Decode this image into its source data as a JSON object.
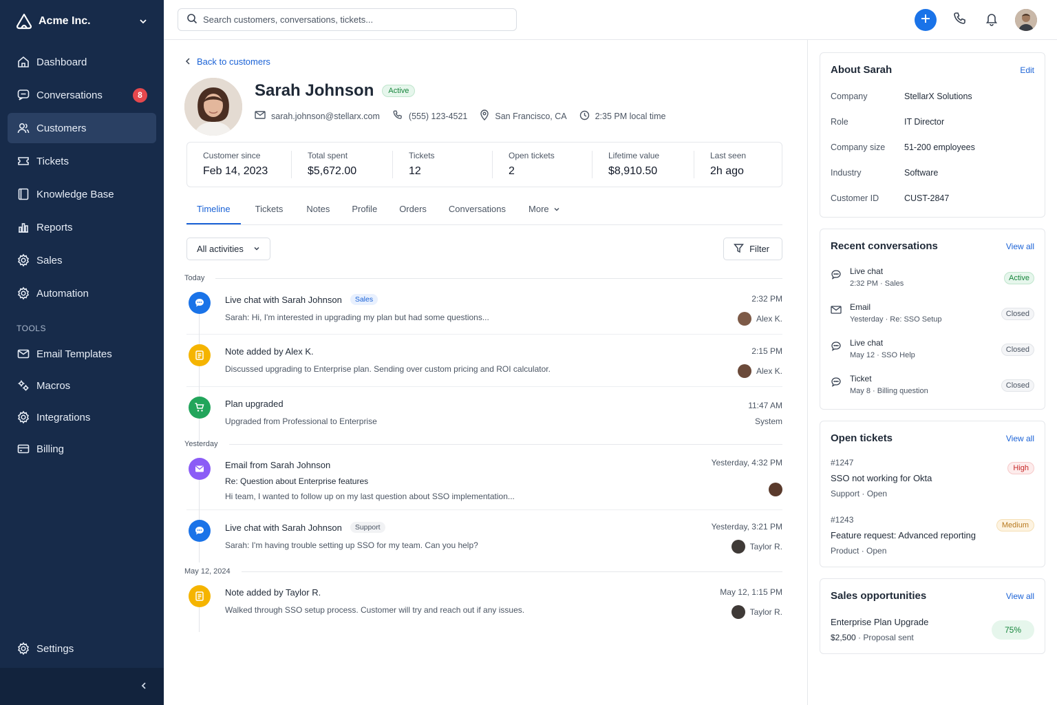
{
  "sidebar": {
    "brand": "Acme Inc.",
    "nav": [
      {
        "label": "Dashboard",
        "icon": "home-icon"
      },
      {
        "label": "Conversations",
        "icon": "chat-icon",
        "badge": "8"
      },
      {
        "label": "Customers",
        "icon": "users-icon",
        "active": true
      },
      {
        "label": "Tickets",
        "icon": "ticket-icon"
      },
      {
        "label": "Knowledge Base",
        "icon": "book-icon"
      },
      {
        "label": "Reports",
        "icon": "bar-chart-icon"
      },
      {
        "label": "Sales",
        "icon": "gear-icon"
      },
      {
        "label": "Automation",
        "icon": "gear-icon"
      }
    ],
    "tools_label": "TOOLS",
    "tools": [
      {
        "label": "Email Templates",
        "icon": "mail-icon"
      },
      {
        "label": "Macros",
        "icon": "macros-icon"
      },
      {
        "label": "Integrations",
        "icon": "gear-icon"
      },
      {
        "label": "Billing",
        "icon": "card-icon"
      }
    ],
    "settings": "Settings"
  },
  "topbar": {
    "search_placeholder": "Search customers, conversations, tickets..."
  },
  "customer": {
    "back": "Back to customers",
    "name": "Sarah Johnson",
    "status": "Active",
    "email": "sarah.johnson@stellarx.com",
    "phone": "(555) 123-4521",
    "location": "San Francisco, CA",
    "local_time": "2:35 PM local time"
  },
  "stats": [
    {
      "label": "Customer since",
      "value": "Feb 14, 2023"
    },
    {
      "label": "Total spent",
      "value": "$5,672.00"
    },
    {
      "label": "Tickets",
      "value": "12"
    },
    {
      "label": "Open tickets",
      "value": "2"
    },
    {
      "label": "Lifetime value",
      "value": "$8,910.50"
    },
    {
      "label": "Last seen",
      "value": "2h ago"
    }
  ],
  "tabs": [
    "Timeline",
    "Tickets",
    "Notes",
    "Profile",
    "Orders",
    "Conversations",
    "More"
  ],
  "filters": {
    "activity": "All activities",
    "filter": "Filter"
  },
  "timeline": {
    "today": "Today",
    "yesterday": "Yesterday",
    "may12": "May 12, 2024",
    "e1": {
      "title": "Live chat with Sarah Johnson",
      "tag": "Sales",
      "text": "Sarah: Hi, I'm interested in upgrading my plan but had some questions...",
      "time": "2:32 PM",
      "who": "Alex K."
    },
    "e2": {
      "title": "Note added by Alex K.",
      "text": "Discussed upgrading to Enterprise plan. Sending over custom pricing and ROI calculator.",
      "time": "2:15 PM",
      "who": "Alex K."
    },
    "e3": {
      "title": "Plan upgraded",
      "text": "Upgraded from Professional to Enterprise",
      "time": "11:47 AM",
      "who": "System"
    },
    "e4": {
      "title": "Email from Sarah Johnson",
      "subject": "Re: Question about Enterprise features",
      "text": "Hi team, I wanted to follow up on my last question about SSO implementation...",
      "time": "Yesterday, 4:32 PM"
    },
    "e5": {
      "title": "Live chat with Sarah Johnson",
      "tag": "Support",
      "text": "Sarah: I'm having trouble setting up SSO for my team. Can you help?",
      "time": "Yesterday, 3:21 PM",
      "who": "Taylor R."
    },
    "e6": {
      "title": "Note added by Taylor R.",
      "text": "Walked through SSO setup process. Customer will try and reach out if any issues.",
      "time": "May 12, 1:15 PM",
      "who": "Taylor R."
    }
  },
  "about": {
    "title": "About Sarah",
    "edit": "Edit",
    "rows": [
      {
        "k": "Company",
        "v": "StellarX Solutions"
      },
      {
        "k": "Role",
        "v": "IT Director"
      },
      {
        "k": "Company size",
        "v": "51-200 employees"
      },
      {
        "k": "Industry",
        "v": "Software"
      },
      {
        "k": "Customer ID",
        "v": "CUST-2847"
      }
    ]
  },
  "recent": {
    "title": "Recent conversations",
    "view_all": "View all",
    "items": [
      {
        "t1": "Live chat",
        "t2": "2:32 PM · Sales",
        "status": "Active"
      },
      {
        "t1": "Email",
        "t2": "Yesterday · Re: SSO Setup",
        "status": "Closed"
      },
      {
        "t1": "Live chat",
        "t2": "May 12 · SSO Help",
        "status": "Closed"
      },
      {
        "t1": "Ticket",
        "t2": "May 8 · Billing question",
        "status": "Closed"
      }
    ]
  },
  "open_tickets": {
    "title": "Open tickets",
    "view_all": "View all",
    "items": [
      {
        "id": "#1247",
        "title": "SSO not working for Okta",
        "meta": "Support · Open",
        "priority": "High"
      },
      {
        "id": "#1243",
        "title": "Feature request: Advanced reporting",
        "meta": "Product · Open",
        "priority": "Medium"
      }
    ]
  },
  "sales": {
    "title": "Sales opportunities",
    "view_all": "View all",
    "name": "Enterprise Plan Upgrade",
    "amount": "$2,500",
    "stage": "Proposal sent",
    "percent": "75%"
  },
  "colors": {
    "sidebar": "#172b4a",
    "accent": "#1a73e8",
    "chat": "#1a73e8",
    "note": "#f5b400",
    "plan": "#22a55b",
    "email": "#8b5cf6"
  }
}
